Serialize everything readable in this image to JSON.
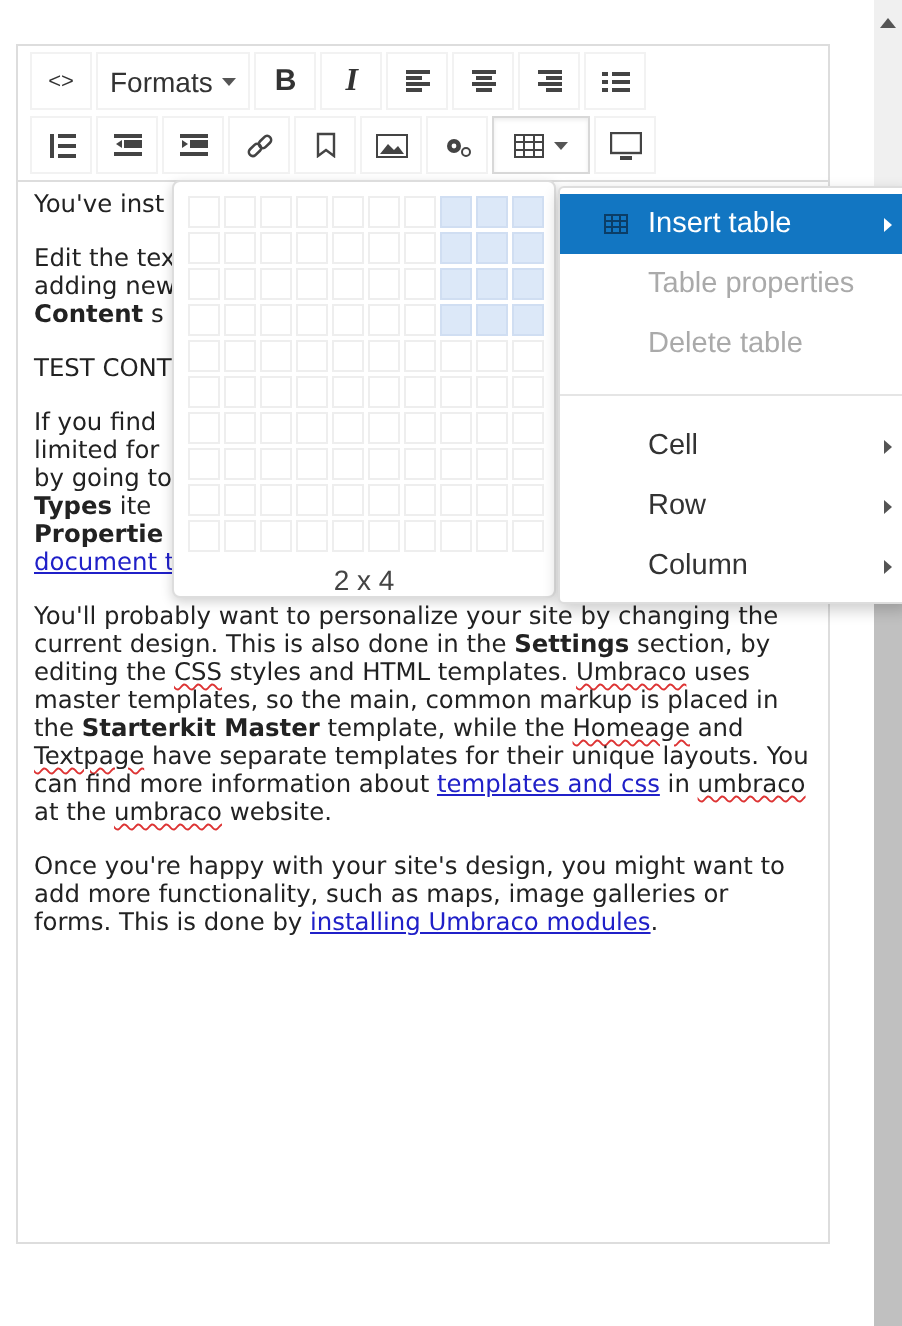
{
  "toolbar": {
    "rows": [
      {
        "buttons": [
          {
            "kind": "code",
            "label": "<>",
            "caret": false,
            "active": false
          },
          {
            "kind": "formats",
            "label": "Formats",
            "caret": true,
            "active": false
          },
          {
            "kind": "bold",
            "label": "B",
            "caret": false,
            "active": false
          },
          {
            "kind": "italic",
            "label": "I",
            "caret": false,
            "active": false
          },
          {
            "kind": "alignleft",
            "caret": false,
            "active": false
          },
          {
            "kind": "aligncenter",
            "caret": false,
            "active": false
          },
          {
            "kind": "alignright",
            "caret": false,
            "active": false
          },
          {
            "kind": "bullist",
            "caret": false,
            "active": false
          }
        ]
      },
      {
        "buttons": [
          {
            "kind": "numlist",
            "caret": false,
            "active": false
          },
          {
            "kind": "outdent",
            "caret": false,
            "active": false
          },
          {
            "kind": "indent",
            "caret": false,
            "active": false
          },
          {
            "kind": "link",
            "caret": false,
            "active": false
          },
          {
            "kind": "anchor",
            "caret": false,
            "active": false
          },
          {
            "kind": "image",
            "caret": false,
            "active": false
          },
          {
            "kind": "macro",
            "caret": false,
            "active": false
          },
          {
            "kind": "table",
            "caret": true,
            "active": true
          },
          {
            "kind": "preview",
            "caret": false,
            "active": false
          }
        ]
      }
    ]
  },
  "content": {
    "paragraphs": [
      {
        "lines": [
          [
            {
              "kind": "text",
              "text": "You've inst"
            }
          ]
        ]
      },
      {
        "lines": [
          [
            {
              "kind": "text",
              "text": "Edit the tex"
            }
          ],
          [
            {
              "kind": "text",
              "text": "adding new"
            }
          ],
          [
            {
              "kind": "text",
              "text": "**Content** s"
            }
          ]
        ]
      },
      {
        "lines": [
          [
            {
              "kind": "text",
              "text": "TEST CONT"
            }
          ]
        ]
      },
      {
        "lines": [
          [
            {
              "kind": "text",
              "text": "If you find"
            }
          ],
          [
            {
              "kind": "text",
              "text": "limited for"
            }
          ],
          [
            {
              "kind": "text",
              "text": "by going to"
            }
          ],
          [
            {
              "kind": "text",
              "text": "**Types** ite"
            }
          ],
          [
            {
              "kind": "text",
              "text": "**Propertie**"
            }
          ],
          [
            {
              "kind": "link",
              "text": "document t"
            }
          ]
        ]
      },
      {
        "lines": [
          [
            {
              "kind": "text",
              "text": "You'll probably want to personalize your site by changing the"
            }
          ],
          [
            {
              "kind": "text",
              "text": "current design. This is also done in the **Settings** section, by"
            }
          ],
          [
            {
              "kind": "text",
              "text": "editing the "
            },
            {
              "kind": "misspelled",
              "text": "CSS"
            },
            {
              "kind": "text",
              "text": " styles and HTML templates. "
            },
            {
              "kind": "misspelled",
              "text": "Umbraco"
            },
            {
              "kind": "text",
              "text": " uses"
            }
          ],
          [
            {
              "kind": "text",
              "text": "master templates, so the main, common markup is placed in"
            }
          ],
          [
            {
              "kind": "text",
              "text": "the **Starterkit Master** template, while the "
            },
            {
              "kind": "misspelled",
              "text": "Homeage"
            },
            {
              "kind": "text",
              "text": " and"
            }
          ],
          [
            {
              "kind": "misspelled",
              "text": "Textpage"
            },
            {
              "kind": "text",
              "text": " have separate templates for their unique layouts. You"
            }
          ],
          [
            {
              "kind": "text",
              "text": "can find more information about "
            },
            {
              "kind": "link",
              "text": "templates and css"
            },
            {
              "kind": "text",
              "text": " in "
            },
            {
              "kind": "misspelled",
              "text": "umbraco"
            }
          ],
          [
            {
              "kind": "text",
              "text": "at the "
            },
            {
              "kind": "misspelled",
              "text": "umbraco"
            },
            {
              "kind": "text",
              "text": " website."
            }
          ]
        ]
      },
      {
        "lines": [
          [
            {
              "kind": "text",
              "text": "Once you're happy with your site's design, you might want to"
            }
          ],
          [
            {
              "kind": "text",
              "text": "add more functionality, such as maps, image galleries or"
            }
          ],
          [
            {
              "kind": "text",
              "text": "forms. This is done by "
            },
            {
              "kind": "link",
              "text": "installing Umbraco modules"
            },
            {
              "kind": "text",
              "text": "."
            }
          ]
        ]
      }
    ]
  },
  "grid": {
    "label": "2 x 4",
    "rows": [
      {
        "cells": [
          {
            "selected": false
          },
          {
            "selected": false
          },
          {
            "selected": false
          },
          {
            "selected": false
          },
          {
            "selected": false
          },
          {
            "selected": false
          },
          {
            "selected": false
          },
          {
            "selected": true
          },
          {
            "selected": true
          },
          {
            "selected": true
          }
        ]
      },
      {
        "cells": [
          {
            "selected": false
          },
          {
            "selected": false
          },
          {
            "selected": false
          },
          {
            "selected": false
          },
          {
            "selected": false
          },
          {
            "selected": false
          },
          {
            "selected": false
          },
          {
            "selected": true
          },
          {
            "selected": true
          },
          {
            "selected": true
          }
        ]
      },
      {
        "cells": [
          {
            "selected": false
          },
          {
            "selected": false
          },
          {
            "selected": false
          },
          {
            "selected": false
          },
          {
            "selected": false
          },
          {
            "selected": false
          },
          {
            "selected": false
          },
          {
            "selected": true
          },
          {
            "selected": true
          },
          {
            "selected": true
          }
        ]
      },
      {
        "cells": [
          {
            "selected": false
          },
          {
            "selected": false
          },
          {
            "selected": false
          },
          {
            "selected": false
          },
          {
            "selected": false
          },
          {
            "selected": false
          },
          {
            "selected": false
          },
          {
            "selected": true
          },
          {
            "selected": true
          },
          {
            "selected": true
          }
        ]
      },
      {
        "cells": [
          {
            "selected": false
          },
          {
            "selected": false
          },
          {
            "selected": false
          },
          {
            "selected": false
          },
          {
            "selected": false
          },
          {
            "selected": false
          },
          {
            "selected": false
          },
          {
            "selected": false
          },
          {
            "selected": false
          },
          {
            "selected": false
          }
        ]
      },
      {
        "cells": [
          {
            "selected": false
          },
          {
            "selected": false
          },
          {
            "selected": false
          },
          {
            "selected": false
          },
          {
            "selected": false
          },
          {
            "selected": false
          },
          {
            "selected": false
          },
          {
            "selected": false
          },
          {
            "selected": false
          },
          {
            "selected": false
          }
        ]
      },
      {
        "cells": [
          {
            "selected": false
          },
          {
            "selected": false
          },
          {
            "selected": false
          },
          {
            "selected": false
          },
          {
            "selected": false
          },
          {
            "selected": false
          },
          {
            "selected": false
          },
          {
            "selected": false
          },
          {
            "selected": false
          },
          {
            "selected": false
          }
        ]
      },
      {
        "cells": [
          {
            "selected": false
          },
          {
            "selected": false
          },
          {
            "selected": false
          },
          {
            "selected": false
          },
          {
            "selected": false
          },
          {
            "selected": false
          },
          {
            "selected": false
          },
          {
            "selected": false
          },
          {
            "selected": false
          },
          {
            "selected": false
          }
        ]
      },
      {
        "cells": [
          {
            "selected": false
          },
          {
            "selected": false
          },
          {
            "selected": false
          },
          {
            "selected": false
          },
          {
            "selected": false
          },
          {
            "selected": false
          },
          {
            "selected": false
          },
          {
            "selected": false
          },
          {
            "selected": false
          },
          {
            "selected": false
          }
        ]
      },
      {
        "cells": [
          {
            "selected": false
          },
          {
            "selected": false
          },
          {
            "selected": false
          },
          {
            "selected": false
          },
          {
            "selected": false
          },
          {
            "selected": false
          },
          {
            "selected": false
          },
          {
            "selected": false
          },
          {
            "selected": false
          },
          {
            "selected": false
          }
        ]
      }
    ]
  },
  "menu": {
    "groups": [
      {
        "items": [
          {
            "label": "Insert table",
            "kind": "table",
            "selected": true,
            "disabled": false,
            "submenu": true
          },
          {
            "label": "Table properties",
            "kind": "plain",
            "selected": false,
            "disabled": true,
            "submenu": false
          },
          {
            "label": "Delete table",
            "kind": "plain",
            "selected": false,
            "disabled": true,
            "submenu": false
          }
        ]
      },
      {
        "items": [
          {
            "label": "Cell",
            "kind": "plain",
            "selected": false,
            "disabled": false,
            "submenu": true
          },
          {
            "label": "Row",
            "kind": "plain",
            "selected": false,
            "disabled": false,
            "submenu": true
          },
          {
            "label": "Column",
            "kind": "plain",
            "selected": false,
            "disabled": false,
            "submenu": true
          }
        ]
      }
    ]
  }
}
